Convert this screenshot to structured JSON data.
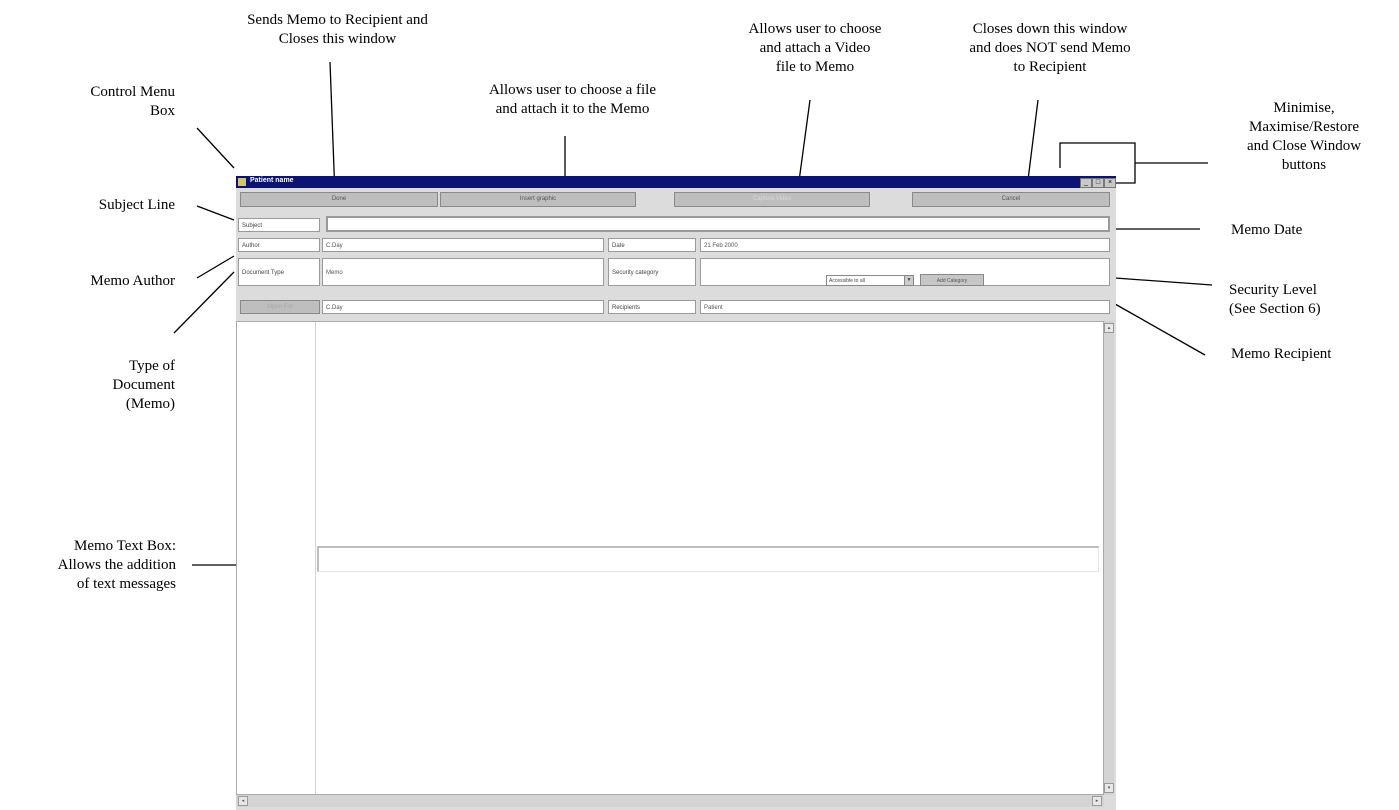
{
  "window": {
    "title": "Patient name",
    "controls": {
      "minimise": "_",
      "maximise": "□",
      "close": "×"
    }
  },
  "toolbar": {
    "done_label": "Done",
    "insert_graphic_label": "Insert graphic",
    "capture_video_label": "Capture Video",
    "cancel_label": "Cancel"
  },
  "form": {
    "subject_label": "Subject",
    "subject_value": "",
    "author_label": "Author",
    "author_value": "C.Day",
    "date_label": "Date",
    "date_value": "21 Feb 2000",
    "doctype_label": "Document Type",
    "doctype_value": "Memo",
    "security_label": "Security category",
    "security_selected": "Accessible to all",
    "add_category_label": "Add Category",
    "open_for_label": "Open For",
    "open_for_value": "C.Day",
    "recipients_label": "Recipients",
    "recipients_value": "Patient"
  },
  "annotations": {
    "control_menu_box": [
      "Control Menu",
      "Box"
    ],
    "subject_line": [
      "Subject Line"
    ],
    "memo_author": [
      "Memo Author"
    ],
    "type_of_document": [
      "Type of",
      "Document",
      "(Memo)"
    ],
    "memo_text_box": [
      "Memo Text Box:",
      "Allows the addition",
      "of text messages"
    ],
    "done": [
      "Sends Memo to Recipient and",
      "Closes this window"
    ],
    "insert_graphic": [
      "Allows user to choose a file",
      "and attach it to the Memo"
    ],
    "video": [
      "Allows user to choose",
      "and attach a Video",
      "file to Memo"
    ],
    "cancel": [
      "Closes down this window",
      "and does NOT send Memo",
      "to Recipient"
    ],
    "window_buttons": [
      "Minimise,",
      "Maximise/Restore",
      "and Close Window",
      "buttons"
    ],
    "memo_date": [
      "Memo Date"
    ],
    "security_level": [
      "Security Level",
      "(See Section 6)"
    ],
    "memo_recipient": [
      "Memo Recipient"
    ]
  }
}
